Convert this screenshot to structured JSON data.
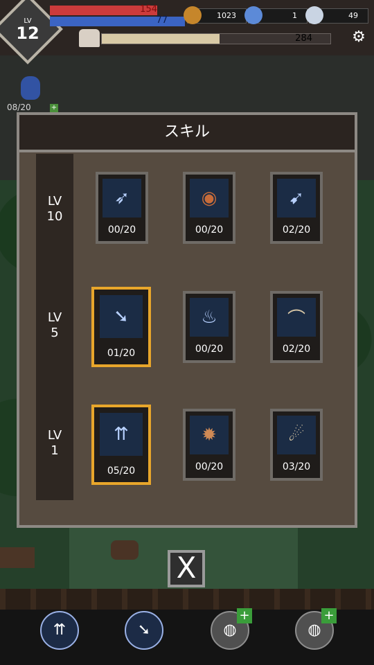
{
  "hud": {
    "level_prefix": "LV",
    "level": "12",
    "hp": "154",
    "mp": "77",
    "coins": "1023",
    "stars": "1",
    "gems": "49",
    "exp": "284",
    "potion_count": "08/20"
  },
  "panel": {
    "title": "スキル",
    "tiers": [
      {
        "label": "LV\n10"
      },
      {
        "label": "LV\n5"
      },
      {
        "label": "LV\n1"
      }
    ],
    "skills": [
      {
        "count": "00/20",
        "icon": "arrow-rain-icon"
      },
      {
        "count": "00/20",
        "icon": "eye-icon"
      },
      {
        "count": "02/20",
        "icon": "crossbow-icon"
      },
      {
        "count": "01/20",
        "icon": "multi-arrow-icon"
      },
      {
        "count": "00/20",
        "icon": "blue-flames-icon"
      },
      {
        "count": "02/20",
        "icon": "boot-icon"
      },
      {
        "count": "05/20",
        "icon": "triple-shot-icon"
      },
      {
        "count": "00/20",
        "icon": "explosion-icon"
      },
      {
        "count": "03/20",
        "icon": "archer-icon"
      }
    ]
  },
  "close": {
    "label": "X"
  },
  "colors": {
    "accent": "#e8a62b",
    "hp": "#cc3b3b",
    "mp": "#3b64c3"
  }
}
